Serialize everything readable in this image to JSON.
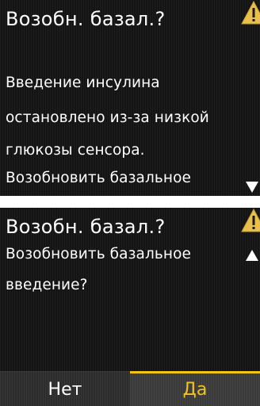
{
  "colors": {
    "background": "#141414",
    "text": "#ffffff",
    "accent": "#f0c419",
    "softkey_left_bg": "#2c2c2c",
    "softkey_right_bg": "#3a3a3a"
  },
  "screen1": {
    "title": "Возобн. базал.?",
    "icon": "warning-icon",
    "lines": [
      "Введение инсулина",
      "остановлено из-за низкой",
      "глюкозы сенсора.",
      "Возобновить базальное"
    ],
    "scroll_indicator": "scroll-down-arrow-icon"
  },
  "screen2": {
    "title": "Возобн. базал.?",
    "icon": "warning-icon",
    "lines": [
      "Возобновить базальное",
      "введение?"
    ],
    "scroll_indicator": "scroll-up-arrow-icon",
    "softkeys": {
      "left": "Нет",
      "right": "Да",
      "selected": "right"
    }
  }
}
